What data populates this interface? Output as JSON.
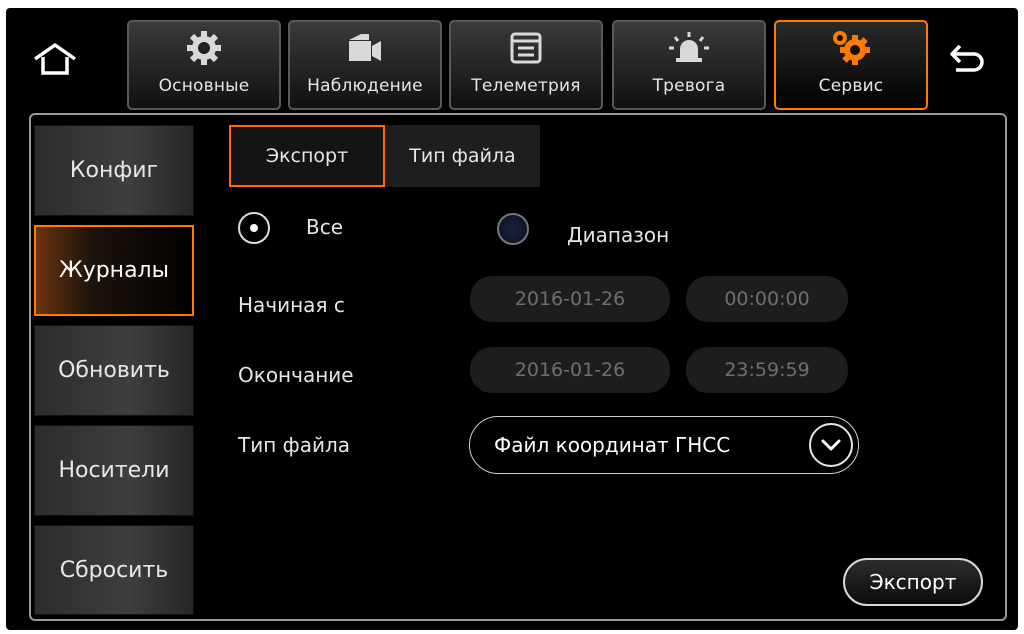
{
  "top_tabs": [
    {
      "label": "Основные",
      "icon": "gear-icon"
    },
    {
      "label": "Наблюдение",
      "icon": "camera-icon"
    },
    {
      "label": "Телеметрия",
      "icon": "window-icon"
    },
    {
      "label": "Тревога",
      "icon": "alarm-icon"
    },
    {
      "label": "Сервис",
      "icon": "gears-icon"
    }
  ],
  "active_top_tab": "Сервис",
  "side_menu": [
    {
      "label": "Конфиг"
    },
    {
      "label": "Журналы"
    },
    {
      "label": "Обновить"
    },
    {
      "label": "Носители"
    },
    {
      "label": "Сбросить"
    }
  ],
  "active_side_item": "Журналы",
  "sub_tabs": [
    {
      "label": "Экспорт"
    },
    {
      "label": "Тип файла"
    }
  ],
  "active_sub_tab": "Экспорт",
  "range": {
    "all_label": "Все",
    "range_label": "Диапазон",
    "selected": "Все"
  },
  "start": {
    "label": "Начиная с",
    "date": "2016-01-26",
    "time": "00:00:00"
  },
  "end": {
    "label": "Окончание",
    "date": "2016-01-26",
    "time": "23:59:59"
  },
  "file_type": {
    "label": "Тип файла",
    "value": "Файл координат ГНСС"
  },
  "export_button": "Экспорт",
  "colors": {
    "accent": "#ff7a00",
    "background": "#000000",
    "text": "#e6e6e6",
    "field": "#1d1d1d"
  }
}
